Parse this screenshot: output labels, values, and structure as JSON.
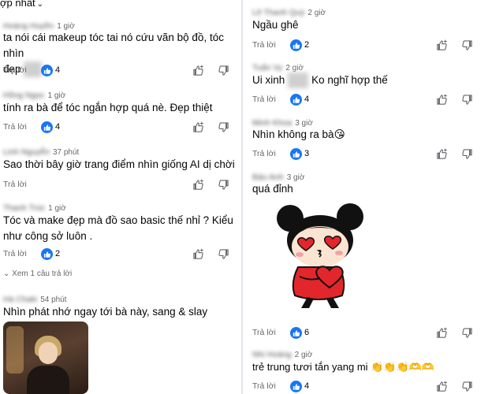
{
  "sort": {
    "label": "ợp nhất"
  },
  "actions": {
    "reply_label": "Trả lời"
  },
  "colors": {
    "like_blue": "#1877f2",
    "meta_gray": "#65676b",
    "text": "#050505"
  },
  "icons": {
    "like": "thumbs-up-icon",
    "add_reaction": "add-reaction-icon",
    "dislike": "thumbs-down-icon",
    "expand": "chevron-down-icon"
  },
  "left": {
    "comments": [
      {
        "name": "Hoàng Huyền",
        "time": "1 giờ",
        "text_lines": [
          "ta nói cái makeup tóc tai nó cứu vãn bộ đồ, tóc nhìn",
          "đẹp"
        ],
        "likes": "4"
      },
      {
        "name": "Hồng Ngọc",
        "time": "1 giờ",
        "text_lines": [
          "tính ra bà để tóc ngắn hợp quá nè. Đẹp thiệt"
        ],
        "likes": "4"
      },
      {
        "name": "Linh Nguyễn",
        "time": "37 phút",
        "text_lines": [
          "Sao thời bây giờ trang điểm nhìn giống AI dị chời"
        ],
        "likes": ""
      },
      {
        "name": "Thanh Trúc",
        "time": "1 giờ",
        "text_lines": [
          "Tóc và make đẹp mà đồ sao basic thế nhỉ ? Kiểu",
          "như công sở luôn ."
        ],
        "likes": "2",
        "more_replies": "Xem 1 câu trả lời"
      },
      {
        "name": "Hà Chaki",
        "time": "54 phút",
        "text_lines": [
          "Nhìn phát nhớ ngay tới bà này, sang & slay"
        ],
        "likes": ""
      }
    ]
  },
  "right": {
    "comments": [
      {
        "name": "Lê Thanh Quý",
        "time": "2 giờ",
        "text_lines": [
          "Ngầu ghê"
        ],
        "likes": "2"
      },
      {
        "name": "Tuấn Vy",
        "time": "2 giờ",
        "text_lines": [
          "Ui xinh",
          "Ko nghĩ hợp thế"
        ],
        "likes": "4"
      },
      {
        "name": "Minh Khoa",
        "time": "3 giờ",
        "text_lines": [
          "Nhìn không ra bà😘"
        ],
        "likes": "3"
      },
      {
        "name": "Bảo Anh",
        "time": "3 giờ",
        "text_lines": [
          "quá đỉnh"
        ],
        "likes": "6"
      },
      {
        "name": "Nhi Hoàng",
        "time": "2 giờ",
        "text_lines": [
          "trẻ trung tươi tắn yang mi 👏👏👏🫶🫶"
        ],
        "likes": "4"
      }
    ]
  }
}
